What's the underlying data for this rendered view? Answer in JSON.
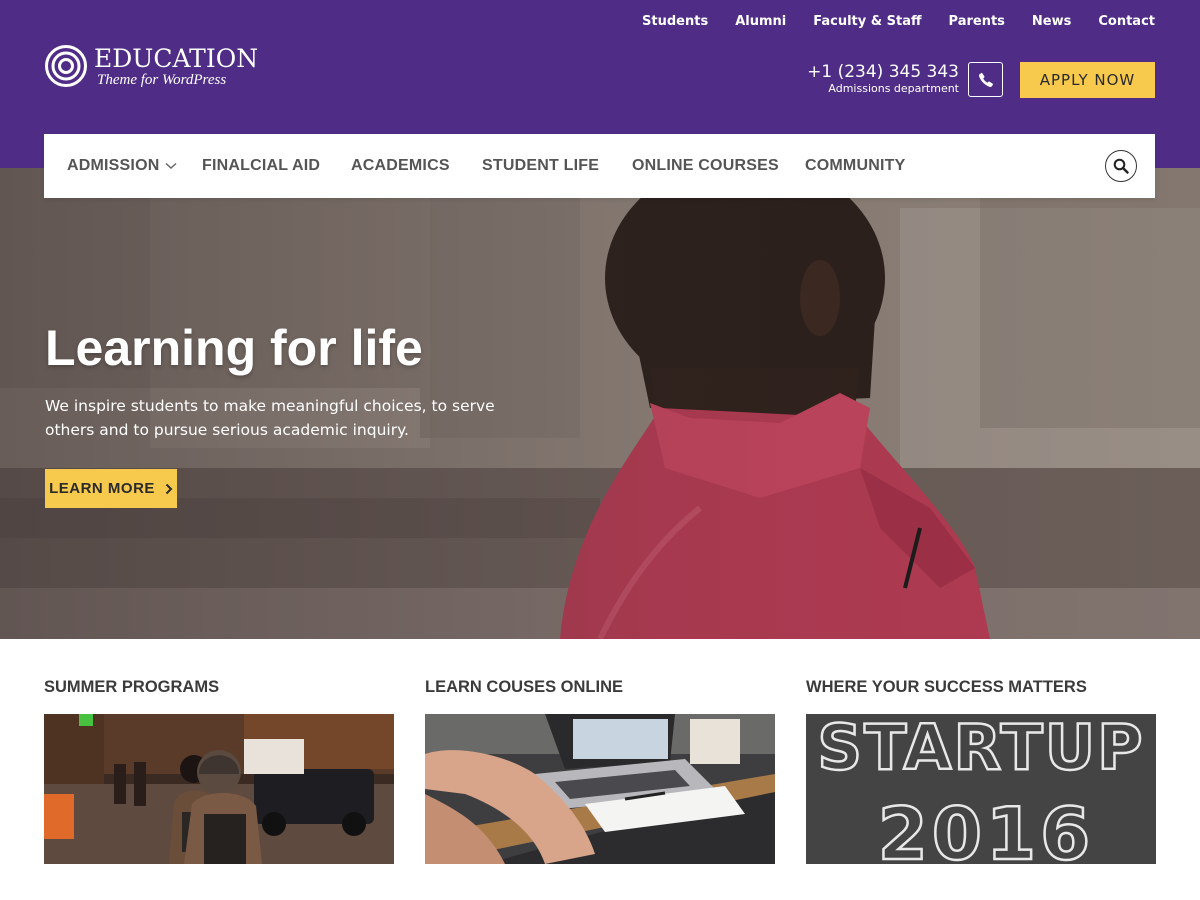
{
  "top_links": [
    "Students",
    "Alumni",
    "Faculty & Staff",
    "Parents",
    "News",
    "Contact"
  ],
  "brand": {
    "title": "EDUCATION",
    "subtitle": "Theme for WordPress",
    "color": "#4f2d86"
  },
  "contact": {
    "phone": "+1 (234) 345 343",
    "department": "Admissions department",
    "phone_icon": "phone-icon"
  },
  "apply_button": "APPLY NOW",
  "accent_color": "#f7c94c",
  "nav": {
    "items": [
      "ADMISSION",
      "FINALCIAL AID",
      "ACADEMICS",
      "STUDENT LIFE",
      "ONLINE COURSES",
      "COMMUNITY"
    ],
    "search_icon": "search-icon"
  },
  "hero": {
    "title": "Learning for life",
    "text": "We inspire students to make meaningful choices, to serve others and to pursue serious academic inquiry.",
    "button": "LEARN MORE"
  },
  "features": [
    {
      "title": "SUMMER PROGRAMS"
    },
    {
      "title": "LEARN COUSES ONLINE"
    },
    {
      "title": "WHERE YOUR SUCCESS MATTERS",
      "image_text_1": "STARTUP",
      "image_text_2": "2016"
    }
  ]
}
